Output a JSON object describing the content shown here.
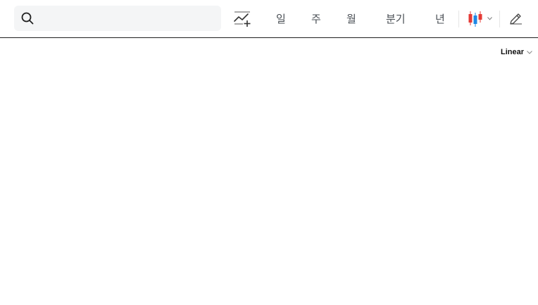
{
  "search": {
    "value": "",
    "placeholder": ""
  },
  "toolbar": {
    "periods": {
      "day": "일",
      "week": "주",
      "month": "월",
      "quarter": "분기",
      "year": "년"
    },
    "icons": {
      "search": "search-icon",
      "add_indicator": "chart-line-plus-icon",
      "chart_type": "candlestick-icon",
      "chart_type_menu": "chevron-down-icon",
      "drawing": "pencil-icon"
    },
    "colors": {
      "candle_up": "#e53935",
      "candle_down": "#1e88e5"
    }
  },
  "chart": {
    "scale_label": "Linear"
  }
}
